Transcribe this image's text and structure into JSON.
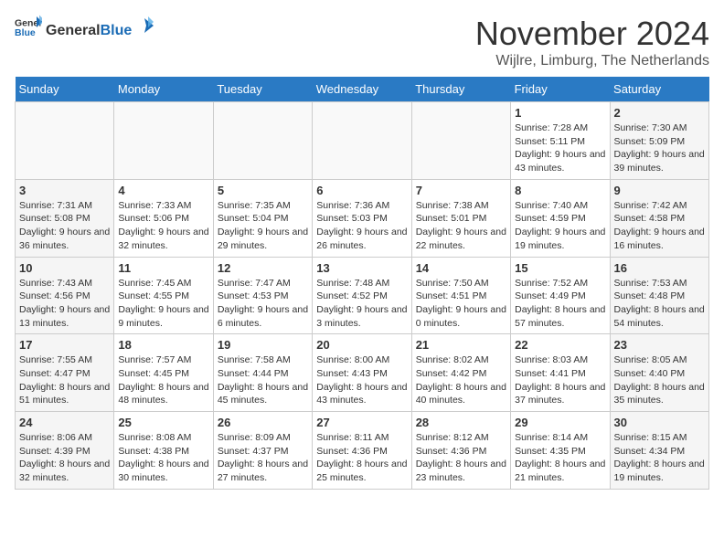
{
  "header": {
    "logo_general": "General",
    "logo_blue": "Blue",
    "month_title": "November 2024",
    "location": "Wijlre, Limburg, The Netherlands"
  },
  "days_of_week": [
    "Sunday",
    "Monday",
    "Tuesday",
    "Wednesday",
    "Thursday",
    "Friday",
    "Saturday"
  ],
  "weeks": [
    [
      {
        "day": "",
        "info": ""
      },
      {
        "day": "",
        "info": ""
      },
      {
        "day": "",
        "info": ""
      },
      {
        "day": "",
        "info": ""
      },
      {
        "day": "",
        "info": ""
      },
      {
        "day": "1",
        "info": "Sunrise: 7:28 AM\nSunset: 5:11 PM\nDaylight: 9 hours and 43 minutes."
      },
      {
        "day": "2",
        "info": "Sunrise: 7:30 AM\nSunset: 5:09 PM\nDaylight: 9 hours and 39 minutes."
      }
    ],
    [
      {
        "day": "3",
        "info": "Sunrise: 7:31 AM\nSunset: 5:08 PM\nDaylight: 9 hours and 36 minutes."
      },
      {
        "day": "4",
        "info": "Sunrise: 7:33 AM\nSunset: 5:06 PM\nDaylight: 9 hours and 32 minutes."
      },
      {
        "day": "5",
        "info": "Sunrise: 7:35 AM\nSunset: 5:04 PM\nDaylight: 9 hours and 29 minutes."
      },
      {
        "day": "6",
        "info": "Sunrise: 7:36 AM\nSunset: 5:03 PM\nDaylight: 9 hours and 26 minutes."
      },
      {
        "day": "7",
        "info": "Sunrise: 7:38 AM\nSunset: 5:01 PM\nDaylight: 9 hours and 22 minutes."
      },
      {
        "day": "8",
        "info": "Sunrise: 7:40 AM\nSunset: 4:59 PM\nDaylight: 9 hours and 19 minutes."
      },
      {
        "day": "9",
        "info": "Sunrise: 7:42 AM\nSunset: 4:58 PM\nDaylight: 9 hours and 16 minutes."
      }
    ],
    [
      {
        "day": "10",
        "info": "Sunrise: 7:43 AM\nSunset: 4:56 PM\nDaylight: 9 hours and 13 minutes."
      },
      {
        "day": "11",
        "info": "Sunrise: 7:45 AM\nSunset: 4:55 PM\nDaylight: 9 hours and 9 minutes."
      },
      {
        "day": "12",
        "info": "Sunrise: 7:47 AM\nSunset: 4:53 PM\nDaylight: 9 hours and 6 minutes."
      },
      {
        "day": "13",
        "info": "Sunrise: 7:48 AM\nSunset: 4:52 PM\nDaylight: 9 hours and 3 minutes."
      },
      {
        "day": "14",
        "info": "Sunrise: 7:50 AM\nSunset: 4:51 PM\nDaylight: 9 hours and 0 minutes."
      },
      {
        "day": "15",
        "info": "Sunrise: 7:52 AM\nSunset: 4:49 PM\nDaylight: 8 hours and 57 minutes."
      },
      {
        "day": "16",
        "info": "Sunrise: 7:53 AM\nSunset: 4:48 PM\nDaylight: 8 hours and 54 minutes."
      }
    ],
    [
      {
        "day": "17",
        "info": "Sunrise: 7:55 AM\nSunset: 4:47 PM\nDaylight: 8 hours and 51 minutes."
      },
      {
        "day": "18",
        "info": "Sunrise: 7:57 AM\nSunset: 4:45 PM\nDaylight: 8 hours and 48 minutes."
      },
      {
        "day": "19",
        "info": "Sunrise: 7:58 AM\nSunset: 4:44 PM\nDaylight: 8 hours and 45 minutes."
      },
      {
        "day": "20",
        "info": "Sunrise: 8:00 AM\nSunset: 4:43 PM\nDaylight: 8 hours and 43 minutes."
      },
      {
        "day": "21",
        "info": "Sunrise: 8:02 AM\nSunset: 4:42 PM\nDaylight: 8 hours and 40 minutes."
      },
      {
        "day": "22",
        "info": "Sunrise: 8:03 AM\nSunset: 4:41 PM\nDaylight: 8 hours and 37 minutes."
      },
      {
        "day": "23",
        "info": "Sunrise: 8:05 AM\nSunset: 4:40 PM\nDaylight: 8 hours and 35 minutes."
      }
    ],
    [
      {
        "day": "24",
        "info": "Sunrise: 8:06 AM\nSunset: 4:39 PM\nDaylight: 8 hours and 32 minutes."
      },
      {
        "day": "25",
        "info": "Sunrise: 8:08 AM\nSunset: 4:38 PM\nDaylight: 8 hours and 30 minutes."
      },
      {
        "day": "26",
        "info": "Sunrise: 8:09 AM\nSunset: 4:37 PM\nDaylight: 8 hours and 27 minutes."
      },
      {
        "day": "27",
        "info": "Sunrise: 8:11 AM\nSunset: 4:36 PM\nDaylight: 8 hours and 25 minutes."
      },
      {
        "day": "28",
        "info": "Sunrise: 8:12 AM\nSunset: 4:36 PM\nDaylight: 8 hours and 23 minutes."
      },
      {
        "day": "29",
        "info": "Sunrise: 8:14 AM\nSunset: 4:35 PM\nDaylight: 8 hours and 21 minutes."
      },
      {
        "day": "30",
        "info": "Sunrise: 8:15 AM\nSunset: 4:34 PM\nDaylight: 8 hours and 19 minutes."
      }
    ]
  ]
}
